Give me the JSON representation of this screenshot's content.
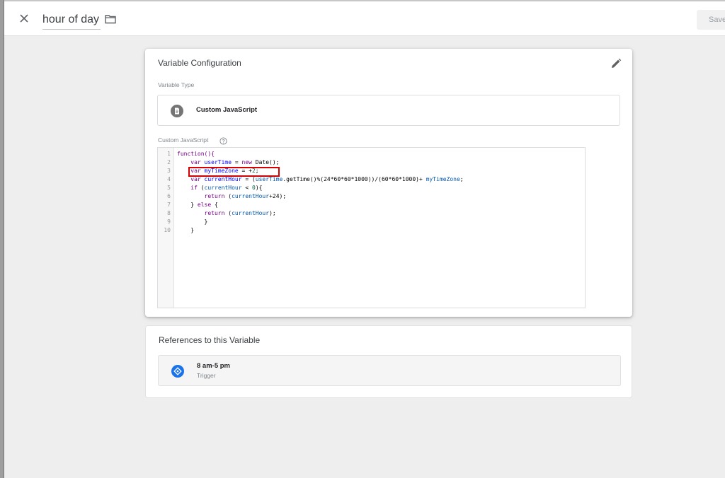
{
  "header": {
    "title": "hour of day",
    "save_label": "Save"
  },
  "config": {
    "title": "Variable Configuration",
    "type_label": "Variable Type",
    "type_name": "Custom JavaScript",
    "code_label": "Custom JavaScript",
    "line_numbers": [
      "1",
      "2",
      "3",
      "4",
      "5",
      "6",
      "7",
      "8",
      "9",
      "10"
    ],
    "code": {
      "l1_a": "function(){",
      "l2_kw": "var ",
      "l2_def": "userTime",
      "l2_eq": " = ",
      "l2_new": "new",
      "l2_rest": " Date();",
      "l3_kw": "var ",
      "l3_def": "myTimeZone",
      "l3_eq": " = +",
      "l3_num": "2",
      "l3_end": ";",
      "l4_kw": "var ",
      "l4_def": "currentHour",
      "l4_eq": " = (",
      "l4_v1": "userTime",
      "l4_mid": ".getTime()%(24*60*60*1000))/(60*60*1000)+ ",
      "l4_v2": "myTimeZone",
      "l4_end": ";",
      "l5_kw": "if",
      "l5_a": " (",
      "l5_v": "currentHour",
      "l5_b": " < ",
      "l5_num": "0",
      "l5_c": "){",
      "l6_kw": "return",
      "l6_a": " (",
      "l6_v": "currentHour",
      "l6_b": "+24);",
      "l7_a": "} ",
      "l7_kw": "else",
      "l7_b": " {",
      "l8_kw": "return",
      "l8_a": " (",
      "l8_v": "currentHour",
      "l8_b": ");",
      "l9": "}",
      "l10": "}"
    }
  },
  "references": {
    "title": "References to this Variable",
    "items": [
      {
        "name": "8 am-5 pm",
        "type": "Trigger"
      }
    ]
  },
  "colors": {
    "highlight": "#d50000",
    "trigger_icon": "#1a73e8",
    "variable_icon": "#757575"
  }
}
